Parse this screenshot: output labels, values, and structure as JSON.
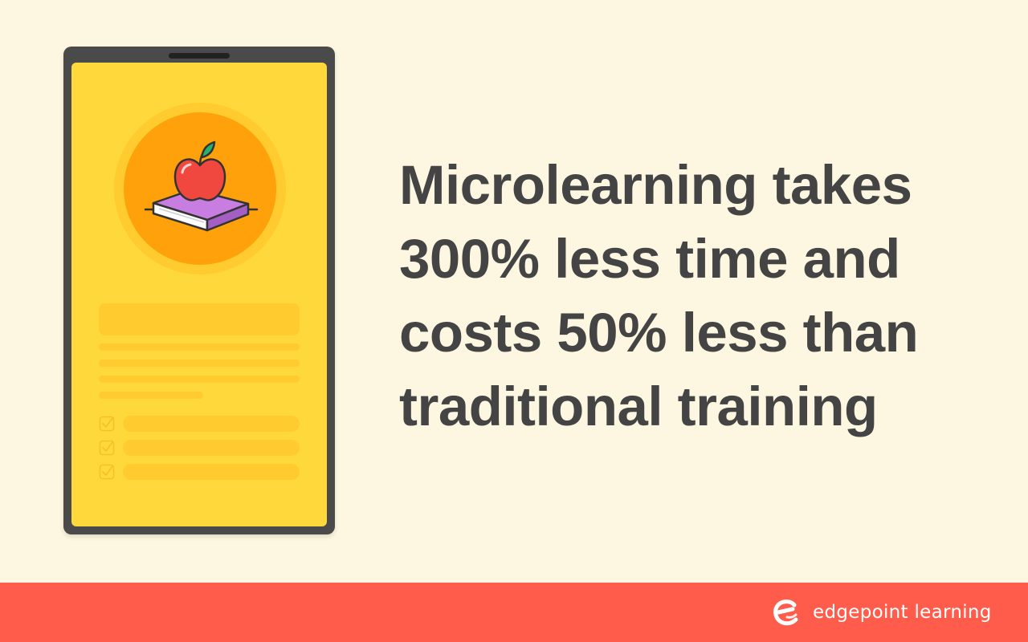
{
  "headline": {
    "lines": [
      "Microlearning takes",
      "300% less time and",
      "costs 50% less than",
      "traditional training"
    ]
  },
  "footer": {
    "brand_name": "edgepoint learning",
    "logo_icon": "edgepoint-e-logo-icon"
  },
  "phone": {
    "illustration_icon": "apple-on-book-icon",
    "checklist_icon": "checkbox-checked-icon"
  },
  "colors": {
    "background": "#fdf7e1",
    "phone_frame": "#4a4a4a",
    "screen": "#ffd93b",
    "placeholder": "#ffcb2e",
    "hero_circle": "#ffa10a",
    "headline_text": "#444444",
    "footer_bar": "#ff5c4b",
    "apple": "#f0483e",
    "book_cover": "#c77ee0"
  }
}
